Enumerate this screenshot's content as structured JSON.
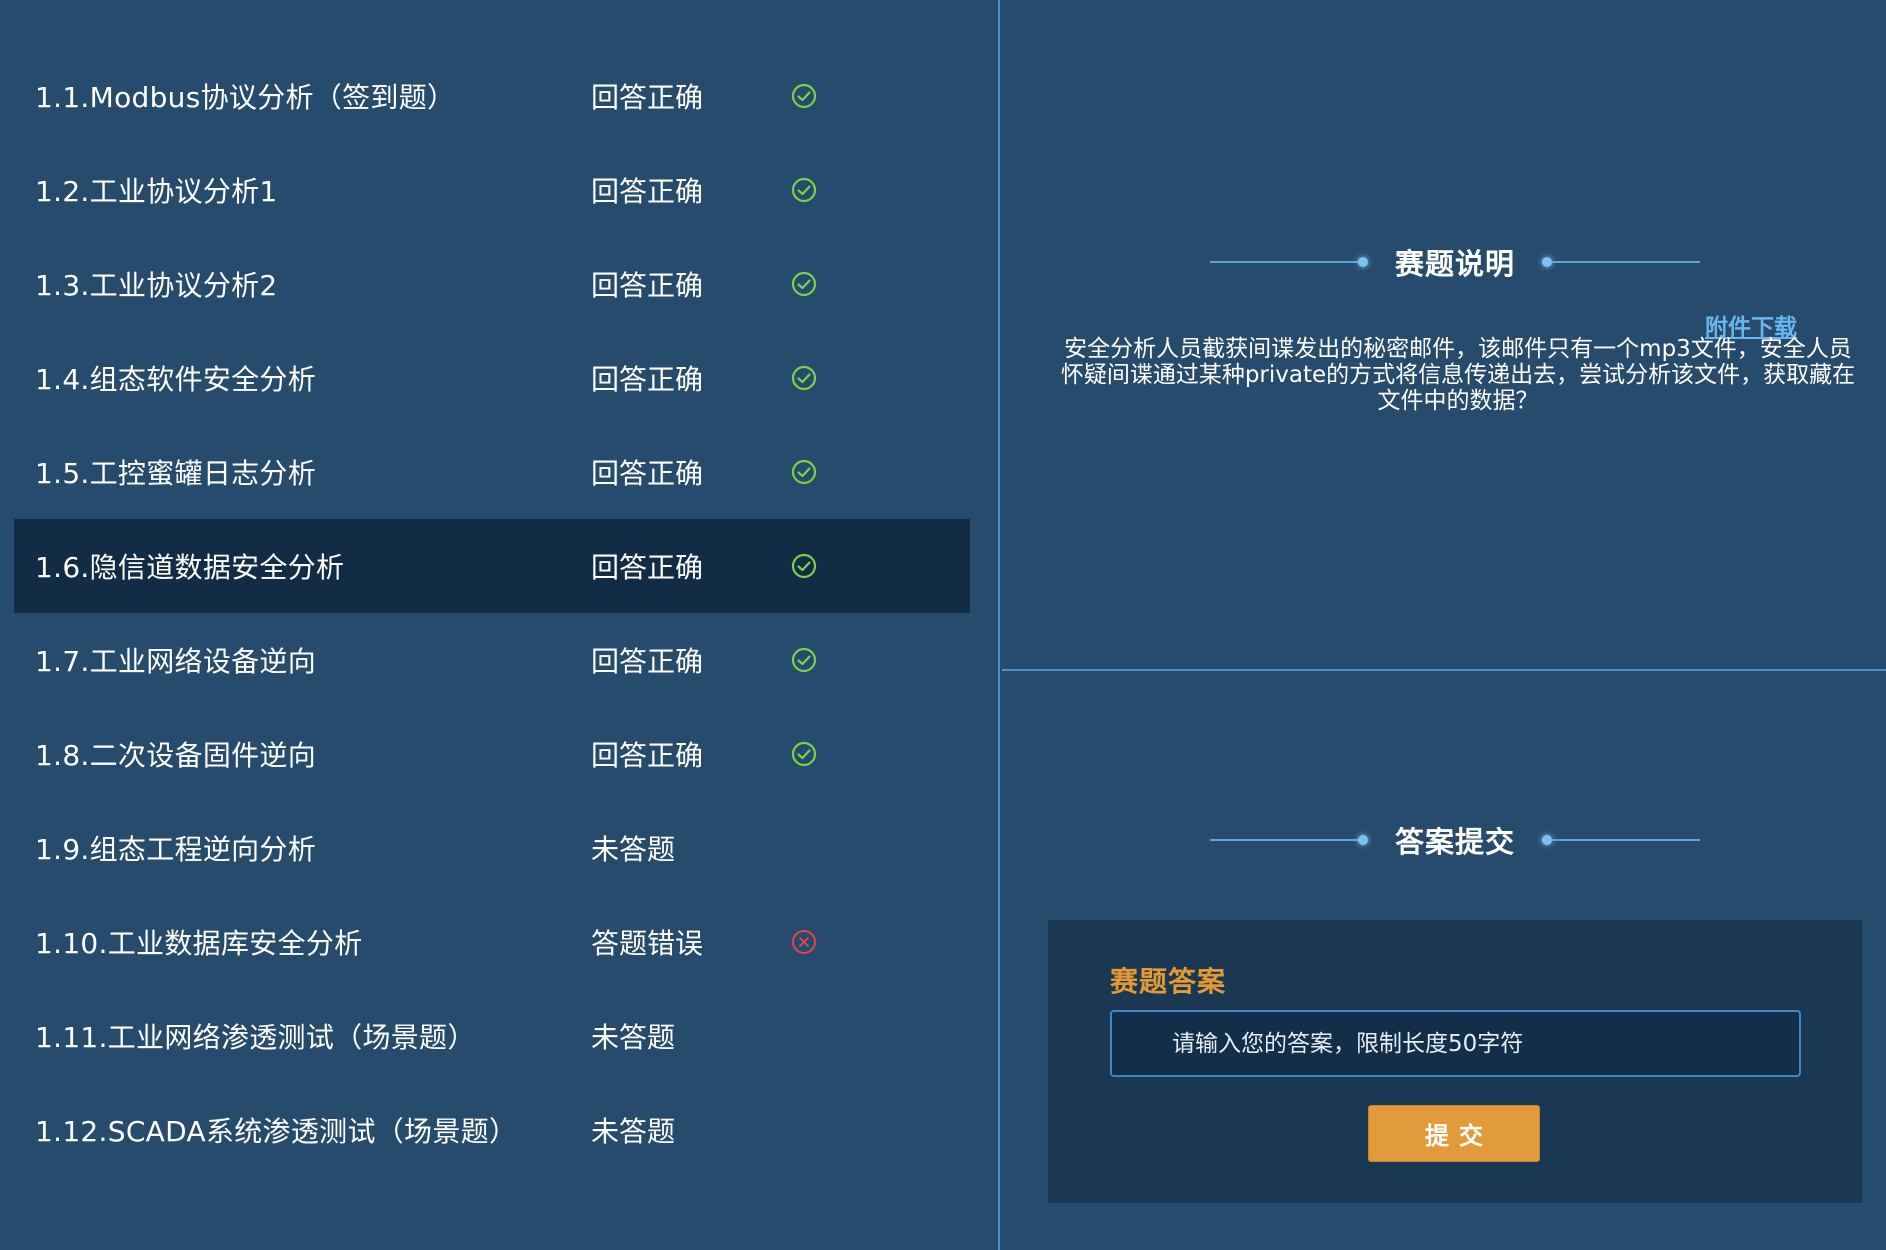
{
  "colors": {
    "background": "#274b6d",
    "active_row": "#132c46",
    "correct": "#7cd04a",
    "wrong": "#e04848",
    "accent": "#e29b3a",
    "link": "#6ab5ee"
  },
  "questions": [
    {
      "title": "1.1.Modbus协议分析（签到题）",
      "status": "回答正确",
      "icon": "check-circle-icon",
      "state": "correct"
    },
    {
      "title": "1.2.工业协议分析1",
      "status": "回答正确",
      "icon": "check-circle-icon",
      "state": "correct"
    },
    {
      "title": "1.3.工业协议分析2",
      "status": "回答正确",
      "icon": "check-circle-icon",
      "state": "correct"
    },
    {
      "title": "1.4.组态软件安全分析",
      "status": "回答正确",
      "icon": "check-circle-icon",
      "state": "correct"
    },
    {
      "title": "1.5.工控蜜罐日志分析",
      "status": "回答正确",
      "icon": "check-circle-icon",
      "state": "correct"
    },
    {
      "title": "1.6.隐信道数据安全分析",
      "status": "回答正确",
      "icon": "check-circle-icon",
      "state": "correct",
      "active": true
    },
    {
      "title": "1.7.工业网络设备逆向",
      "status": "回答正确",
      "icon": "check-circle-icon",
      "state": "correct"
    },
    {
      "title": "1.8.二次设备固件逆向",
      "status": "回答正确",
      "icon": "check-circle-icon",
      "state": "correct"
    },
    {
      "title": "1.9.组态工程逆向分析",
      "status": "未答题",
      "icon": "",
      "state": "none"
    },
    {
      "title": "1.10.工业数据库安全分析",
      "status": "答题错误",
      "icon": "x-circle-icon",
      "state": "wrong"
    },
    {
      "title": "1.11.工业网络渗透测试（场景题）",
      "status": "未答题",
      "icon": "",
      "state": "none"
    },
    {
      "title": "1.12.SCADA系统渗透测试（场景题）",
      "status": "未答题",
      "icon": "",
      "state": "none"
    }
  ],
  "description": {
    "heading": "赛题说明",
    "attachment_link": "附件下载",
    "text": "安全分析人员截获间谍发出的秘密邮件，该邮件只有一个mp3文件，安全人员怀疑间谍通过某种private的方式将信息传递出去，尝试分析该文件，获取藏在文件中的数据？"
  },
  "answer": {
    "heading": "答案提交",
    "label": "赛题答案",
    "placeholder": "请输入您的答案，限制长度50字符",
    "submit_label": "提交"
  }
}
